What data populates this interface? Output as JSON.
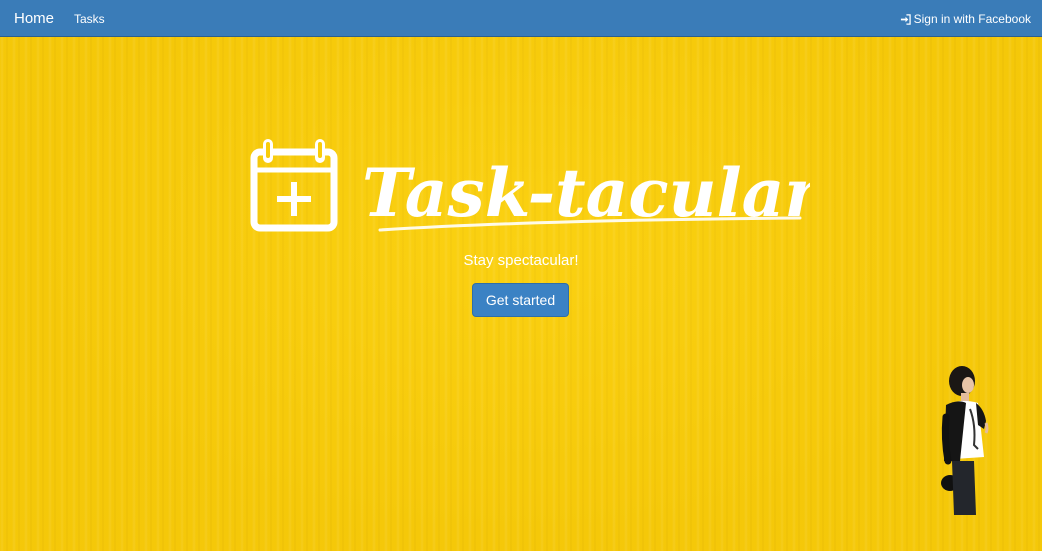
{
  "navbar": {
    "brand": "Home",
    "links": [
      {
        "label": "Tasks"
      }
    ],
    "signin_label": "Sign in with Facebook",
    "signin_icon": "sign-in-icon",
    "color": "#3a7cb8"
  },
  "hero": {
    "background_color": "#f9cd0a",
    "logo_icon": "calendar-plus-icon",
    "wordmark": "Task-tacular",
    "tagline": "Stay spectacular!",
    "cta_label": "Get started",
    "cta_color": "#3b82c4"
  }
}
